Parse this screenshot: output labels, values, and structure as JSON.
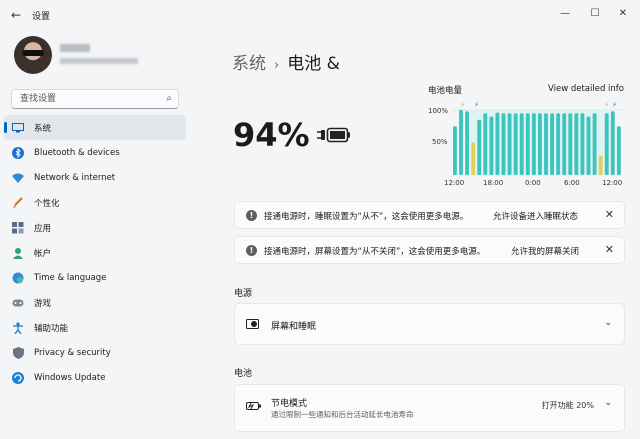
{
  "window": {
    "title": "设置",
    "controls": [
      "—",
      "☐",
      "✕"
    ]
  },
  "search": {
    "placeholder": "查找设置"
  },
  "sidebar": {
    "items": [
      {
        "label": "系统",
        "icon": "system-icon",
        "active": true
      },
      {
        "label": "Bluetooth & devices",
        "icon": "bluetooth-icon"
      },
      {
        "label": "Network & internet",
        "icon": "wifi-icon"
      },
      {
        "label": "个性化",
        "icon": "brush-icon"
      },
      {
        "label": "应用",
        "icon": "apps-icon"
      },
      {
        "label": "帐户",
        "icon": "account-icon"
      },
      {
        "label": "Time & language",
        "icon": "globe-clock-icon"
      },
      {
        "label": "游戏",
        "icon": "gamepad-icon"
      },
      {
        "label": "辅助功能",
        "icon": "accessibility-icon"
      },
      {
        "label": "Privacy & security",
        "icon": "shield-icon"
      },
      {
        "label": "Windows Update",
        "icon": "update-icon"
      }
    ]
  },
  "header": {
    "crumb": "系统",
    "separator": "›",
    "title": "电池 &"
  },
  "battery": {
    "percent": "94%"
  },
  "chart": {
    "title": "电池电量",
    "link": "View detailed info",
    "y_ticks": [
      "100%",
      "50%"
    ],
    "x_ticks": [
      "12:00",
      "18:00",
      "0:00",
      "6:00",
      "12:00"
    ]
  },
  "chart_data": {
    "type": "bar",
    "ylim": [
      0,
      100
    ],
    "series": [
      {
        "values": [
          75,
          100,
          98,
          50,
          85,
          95,
          90,
          96,
          95,
          95,
          95,
          95,
          95,
          95,
          95,
          95,
          95,
          95,
          95,
          95,
          95,
          95,
          90,
          95,
          30,
          95,
          98,
          75
        ]
      }
    ],
    "highlight_colors": {
      "charging": "#3cc4bf",
      "battery": "#e8cd55"
    }
  },
  "notices": [
    {
      "text": "接通电源时，睡眠设置为“从不”，这会使用更多电源。",
      "link": "允许设备进入睡眠状态"
    },
    {
      "text": "接通电源时，屏幕设置为“从不关闭”，这会使用更多电源。",
      "link": "允许我的屏幕关闭"
    }
  ],
  "sections": {
    "power": {
      "label": "电源",
      "row_title": "屏幕和睡眠"
    },
    "battery": {
      "label": "电池",
      "row_title": "节电模式",
      "row_sub": "通过限制一些通知和后台活动延长电池寿命",
      "row_value": "打开功能 20%"
    }
  },
  "colors": {
    "accent": "#0067c0",
    "teal": "#3cc4bf",
    "yellow": "#e8cd55"
  }
}
